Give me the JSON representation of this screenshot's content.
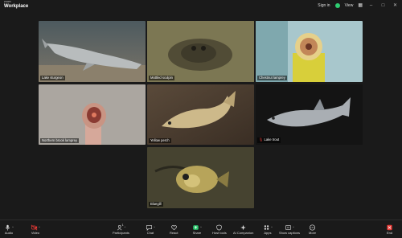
{
  "app": {
    "logo_small": "zoom",
    "logo_name": "Workplace",
    "sign_in": "Sign in",
    "view": "View"
  },
  "tiles": [
    {
      "name": "Lake sturgeon",
      "subject": "sturgeon"
    },
    {
      "name": "Mottled sculpin",
      "subject": "sculpin",
      "active": true
    },
    {
      "name": "Chestnut lamprey",
      "subject": "lamprey-mouth"
    },
    {
      "name": "Northern brook lamprey",
      "subject": "lamprey-held"
    },
    {
      "name": "Yellow perch",
      "subject": "perch"
    },
    {
      "name": "Lake trout",
      "subject": "trout",
      "mic_muted": true
    },
    {
      "name": "Bluegill",
      "subject": "bluegill"
    }
  ],
  "toolbar": {
    "audio": "Audio",
    "video": "Video",
    "participants": "Participants",
    "participants_count": "1",
    "chat": "Chat",
    "react": "React",
    "share": "Share",
    "host_tools": "Host tools",
    "ai_companion": "AI Companion",
    "apps": "Apps",
    "captions": "Show captions",
    "more": "More",
    "end": "End"
  },
  "colors": {
    "active_speaker": "#c7f23c",
    "share_green": "#2ecc71",
    "end_red": "#e53935",
    "muted_red": "#e53935"
  }
}
